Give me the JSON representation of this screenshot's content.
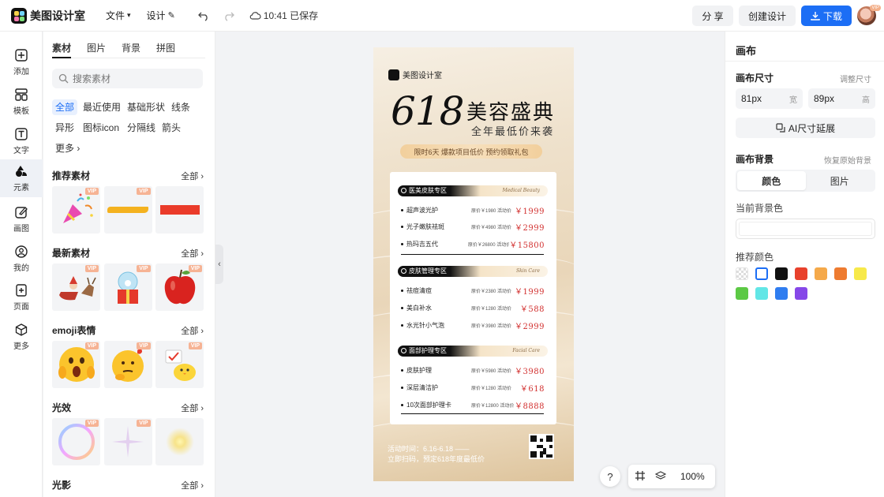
{
  "app": {
    "name": "美图设计室",
    "menus": [
      {
        "label": "文件"
      },
      {
        "label": "设计"
      }
    ],
    "save_status": "10:41 已保存",
    "share_label": "分 享",
    "create_label": "创建设计",
    "download_label": "下载",
    "avatar_badge": "VIP"
  },
  "rail": [
    {
      "label": "添加",
      "icon": "plus-square-icon"
    },
    {
      "label": "模板",
      "icon": "template-icon"
    },
    {
      "label": "文字",
      "icon": "text-icon"
    },
    {
      "label": "元素",
      "icon": "element-icon",
      "active": true
    },
    {
      "label": "画图",
      "icon": "draw-icon"
    },
    {
      "label": "我的",
      "icon": "user-icon"
    },
    {
      "label": "页面",
      "icon": "page-icon"
    },
    {
      "label": "更多",
      "icon": "cube-icon"
    }
  ],
  "panel": {
    "tabs": [
      "素材",
      "图片",
      "背景",
      "拼图"
    ],
    "active_tab": "素材",
    "search_placeholder": "搜索素材",
    "chips": [
      "全部",
      "最近使用",
      "基础形状",
      "线条",
      "异形",
      "图标icon",
      "分隔线",
      "箭头",
      "更多"
    ],
    "active_chip": "全部",
    "all_label": "全部",
    "vip_label": "VIP",
    "sections": [
      {
        "title": "推荐素材",
        "items": [
          "party-popper",
          "yellow-brush-stroke",
          "red-bar"
        ]
      },
      {
        "title": "最新素材",
        "items": [
          "santa-sleigh",
          "snow-globe-gift",
          "red-apple"
        ]
      },
      {
        "title": "emoji表情",
        "items": [
          "shocked-emoji",
          "thinking-emoji",
          "chick-emoji"
        ]
      },
      {
        "title": "光效",
        "items": [
          "bubble-ring",
          "sparkle-star",
          "glow-flare"
        ]
      },
      {
        "title": "光影",
        "items": []
      }
    ]
  },
  "poster": {
    "brand": "美图设计室",
    "big_number": "618",
    "title": "美容盛典",
    "subtitle": "全年最低价来袭",
    "strip": "限时6天 爆款项目低价 预约领取礼包",
    "sections": [
      {
        "label": "医美皮肤专区",
        "tag": "Medical Beauty",
        "rows": [
          {
            "name": "超声波光护",
            "orig": "原价￥1980  活动价",
            "price": "￥1999"
          },
          {
            "name": "光子嫩肤祛斑",
            "orig": "原价￥4980  活动价",
            "price": "￥2999"
          },
          {
            "name": "热玛吉五代",
            "orig": "原价￥26800  活动价",
            "price": "￥15800"
          }
        ]
      },
      {
        "label": "皮肤管理专区",
        "tag": "Skin Care",
        "rows": [
          {
            "name": "祛痘清痘",
            "orig": "原价￥2380  活动价",
            "price": "￥1999"
          },
          {
            "name": "美白补水",
            "orig": "原价￥1280  活动价",
            "price": "￥588"
          },
          {
            "name": "水光针小气泡",
            "orig": "原价￥3980  活动价",
            "price": "￥2999"
          }
        ]
      },
      {
        "label": "面部护理专区",
        "tag": "Facial Care",
        "rows": [
          {
            "name": "皮肤护理",
            "orig": "原价￥5980  活动价",
            "price": "￥3980"
          },
          {
            "name": "深层清洁护",
            "orig": "原价￥1280  活动价",
            "price": "￥618"
          },
          {
            "name": "10次面部护理卡",
            "orig": "原价￥12800  活动价",
            "price": "￥8888"
          }
        ]
      }
    ],
    "footer_line1": "活动时间：6.16-6.18 ——",
    "footer_line2": "立即扫码，预定618年度最低价"
  },
  "canvas_tools": {
    "help": "?",
    "zoom": "100%"
  },
  "right_panel": {
    "title": "画布",
    "size_label": "画布尺寸",
    "adjust_size": "调整尺寸",
    "width_value": "81px",
    "width_unit": "宽",
    "height_value": "89px",
    "height_unit": "高",
    "ai_extend": "AI尺寸延展",
    "bg_label": "画布背景",
    "restore_bg": "恢复原始背景",
    "seg_color": "颜色",
    "seg_image": "图片",
    "current_color_label": "当前背景色",
    "current_color": "#ffffff",
    "recommend_label": "推荐颜色",
    "swatches": [
      "transparent",
      "#ffffff",
      "#111111",
      "#e8412c",
      "#f5a94a",
      "#ee7b30",
      "#f7e94a",
      "#5cc945",
      "#62e6e6",
      "#2f7df0",
      "#8647e8"
    ]
  }
}
